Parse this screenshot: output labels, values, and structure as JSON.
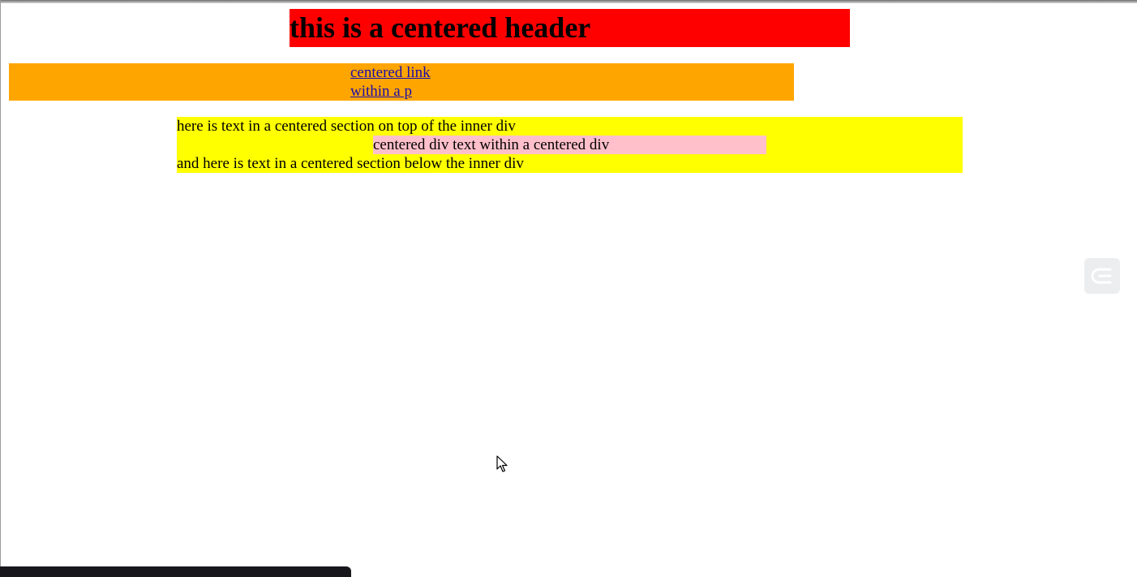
{
  "header": {
    "title": "this is a centered header",
    "color": "#ff0000"
  },
  "link_section": {
    "color": "#ffa500",
    "links": [
      "centered link",
      "within a p"
    ]
  },
  "centered_section": {
    "color": "#ffff00",
    "top_text": "here is text in a centered section on top of the inner div",
    "inner_div_text": "centered div text within a centered div",
    "inner_div_color": "#ffc0cb",
    "bottom_text": "and here is text in a centered section below the inner div"
  },
  "side_widget": {
    "icon": "extension-logo-icon"
  },
  "cursor": {
    "icon": "mouse-pointer-icon"
  }
}
